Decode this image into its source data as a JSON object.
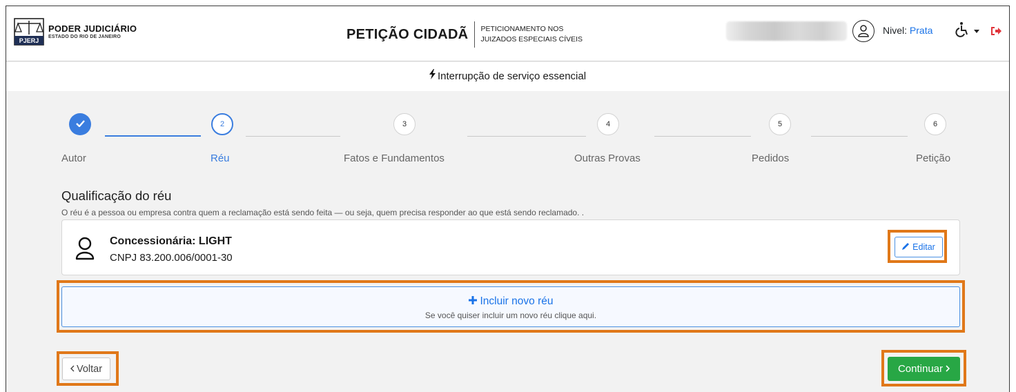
{
  "header": {
    "logo_title": "PODER JUDICIÁRIO",
    "logo_subtitle": "ESTADO DO RIO DE JANEIRO",
    "logo_abbrev": "PJERJ",
    "app_title": "PETIÇÃO CIDADÃ",
    "app_subtitle_line1": "PETICIONAMENTO NOS",
    "app_subtitle_line2": "JUIZADOS ESPECIAIS CÍVEIS",
    "nivel_label": "Nivel:",
    "nivel_value": "Prata",
    "icons": [
      "user-circle-icon",
      "wheelchair-icon",
      "caret-down-icon",
      "sign-out-icon"
    ]
  },
  "subheader": {
    "text": "Interrupção de serviço essencial",
    "icon": "bolt-icon"
  },
  "stepper": {
    "current_step": 2,
    "steps": [
      {
        "number": "1",
        "label": "Autor",
        "status": "done"
      },
      {
        "number": "2",
        "label": "Réu",
        "status": "active"
      },
      {
        "number": "3",
        "label": "Fatos e Fundamentos",
        "status": "todo"
      },
      {
        "number": "4",
        "label": "Outras Provas",
        "status": "todo"
      },
      {
        "number": "5",
        "label": "Pedidos",
        "status": "todo"
      },
      {
        "number": "6",
        "label": "Petição",
        "status": "todo"
      }
    ]
  },
  "section": {
    "title": "Qualificação do réu",
    "description": "O réu é a pessoa ou empresa contra quem a reclamação está sendo feita — ou seja, quem precisa responder ao que está sendo reclamado. ."
  },
  "defendant": {
    "name": "Concessionária: LIGHT",
    "cnpj": "CNPJ 83.200.006/0001-30",
    "edit_label": "Editar"
  },
  "add_defendant": {
    "label": "Incluir novo réu",
    "hint": "Se você quiser incluir um novo réu clique aqui."
  },
  "navigation": {
    "back_label": "Voltar",
    "next_label": "Continuar"
  },
  "colors": {
    "primary": "#3a7ddf",
    "link": "#1a73e8",
    "success": "#28a745",
    "highlight": "#e07819",
    "exit": "#e0343a"
  }
}
